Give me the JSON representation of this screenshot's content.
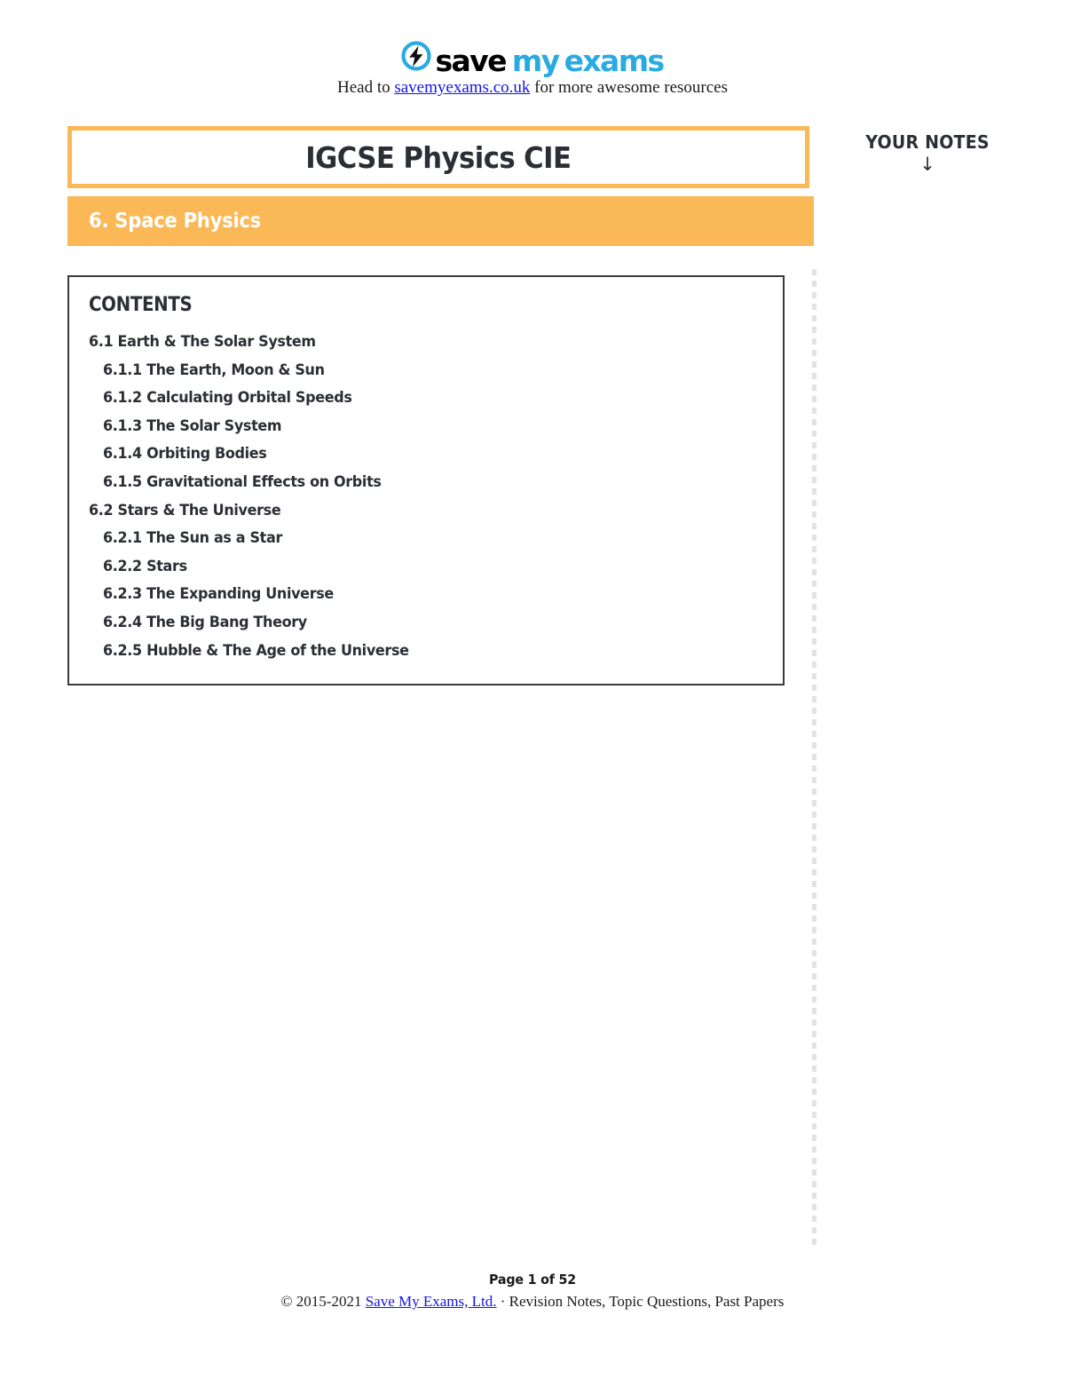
{
  "header": {
    "logo": {
      "icon": "lightning-bolt-circle-icon",
      "word_save": "save",
      "word_my": "my",
      "word_exams": "exams",
      "color_brand_blue": "#29ABE2",
      "color_brand_black": "#000000"
    },
    "tagline_before": "Head to ",
    "tagline_link": "savemyexams.co.uk",
    "tagline_after": " for more awesome resources"
  },
  "title_box": {
    "title": "IGCSE Physics CIE",
    "border_color": "#FBB857"
  },
  "topic_bar": {
    "label": "6. Space Physics",
    "background_color": "#FBB857",
    "text_color": "#FFFFFF"
  },
  "your_notes": {
    "label": "YOUR NOTES",
    "arrow": "↓"
  },
  "contents": {
    "heading": "CONTENTS",
    "entries": [
      {
        "text": "6.1 Earth & The Solar System",
        "level": 1
      },
      {
        "text": "6.1.1 The Earth, Moon & Sun",
        "level": 2
      },
      {
        "text": "6.1.2 Calculating Orbital Speeds",
        "level": 2
      },
      {
        "text": "6.1.3 The Solar System",
        "level": 2
      },
      {
        "text": "6.1.4 Orbiting Bodies",
        "level": 2
      },
      {
        "text": "6.1.5 Gravitational Effects on Orbits",
        "level": 2
      },
      {
        "text": "6.2 Stars & The Universe",
        "level": 1
      },
      {
        "text": "6.2.1 The Sun as a Star",
        "level": 2
      },
      {
        "text": "6.2.2 Stars",
        "level": 2
      },
      {
        "text": "6.2.3 The Expanding Universe",
        "level": 2
      },
      {
        "text": "6.2.4 The Big Bang Theory",
        "level": 2
      },
      {
        "text": "6.2.5 Hubble & The Age of the Universe",
        "level": 2
      }
    ]
  },
  "footer": {
    "page_label": "Page 1 of 52",
    "copyright_before": "© 2015-2021 ",
    "copyright_link": "Save My Exams, Ltd.",
    "copyright_after": " · Revision Notes, Topic Questions, Past Papers"
  }
}
